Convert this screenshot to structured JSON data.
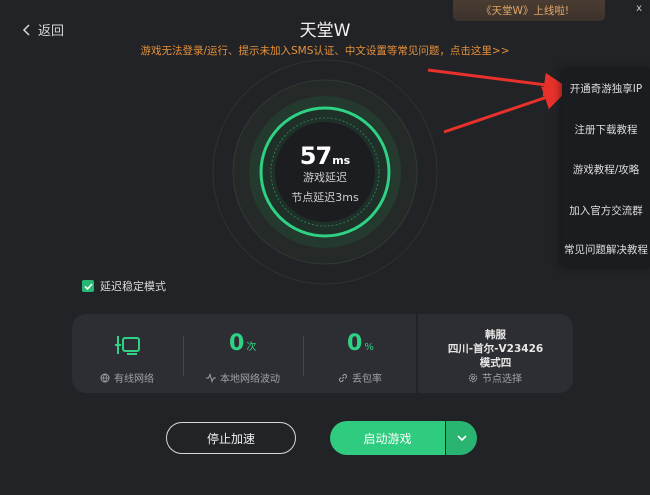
{
  "header": {
    "back_label": "返回",
    "title": "天堂W",
    "notice": "游戏无法登录/运行、提示未加入SMS认证、中文设置等常见问题，点击这里>>"
  },
  "toast": {
    "text": "《天堂W》上线啦!",
    "close": "x"
  },
  "gauge": {
    "latency_value": "57",
    "latency_unit": "ms",
    "latency_label": "游戏延迟",
    "node_latency": "节点延迟3ms",
    "accent_color": "#2fd185"
  },
  "side_menu": {
    "items": [
      {
        "label": "开通奇游独享IP"
      },
      {
        "label": "注册下载教程"
      },
      {
        "label": "游戏教程/攻略"
      },
      {
        "label": "加入官方交流群"
      },
      {
        "label": "常见问题解决教程"
      }
    ]
  },
  "stable_mode": {
    "label": "延迟稳定模式",
    "checked": true
  },
  "stats": {
    "network": {
      "label": "有线网络",
      "icon": "wired-network-icon"
    },
    "fluctuation": {
      "value": "0",
      "unit": "次",
      "label": "本地网络波动"
    },
    "packet_loss": {
      "value": "0",
      "unit": "%",
      "label": "丢包率"
    }
  },
  "region": {
    "server": "韩服",
    "node": "四川-首尔-V23426",
    "mode": "模式四",
    "select_label": "节点选择"
  },
  "actions": {
    "stop_label": "停止加速",
    "start_label": "启动游戏"
  }
}
